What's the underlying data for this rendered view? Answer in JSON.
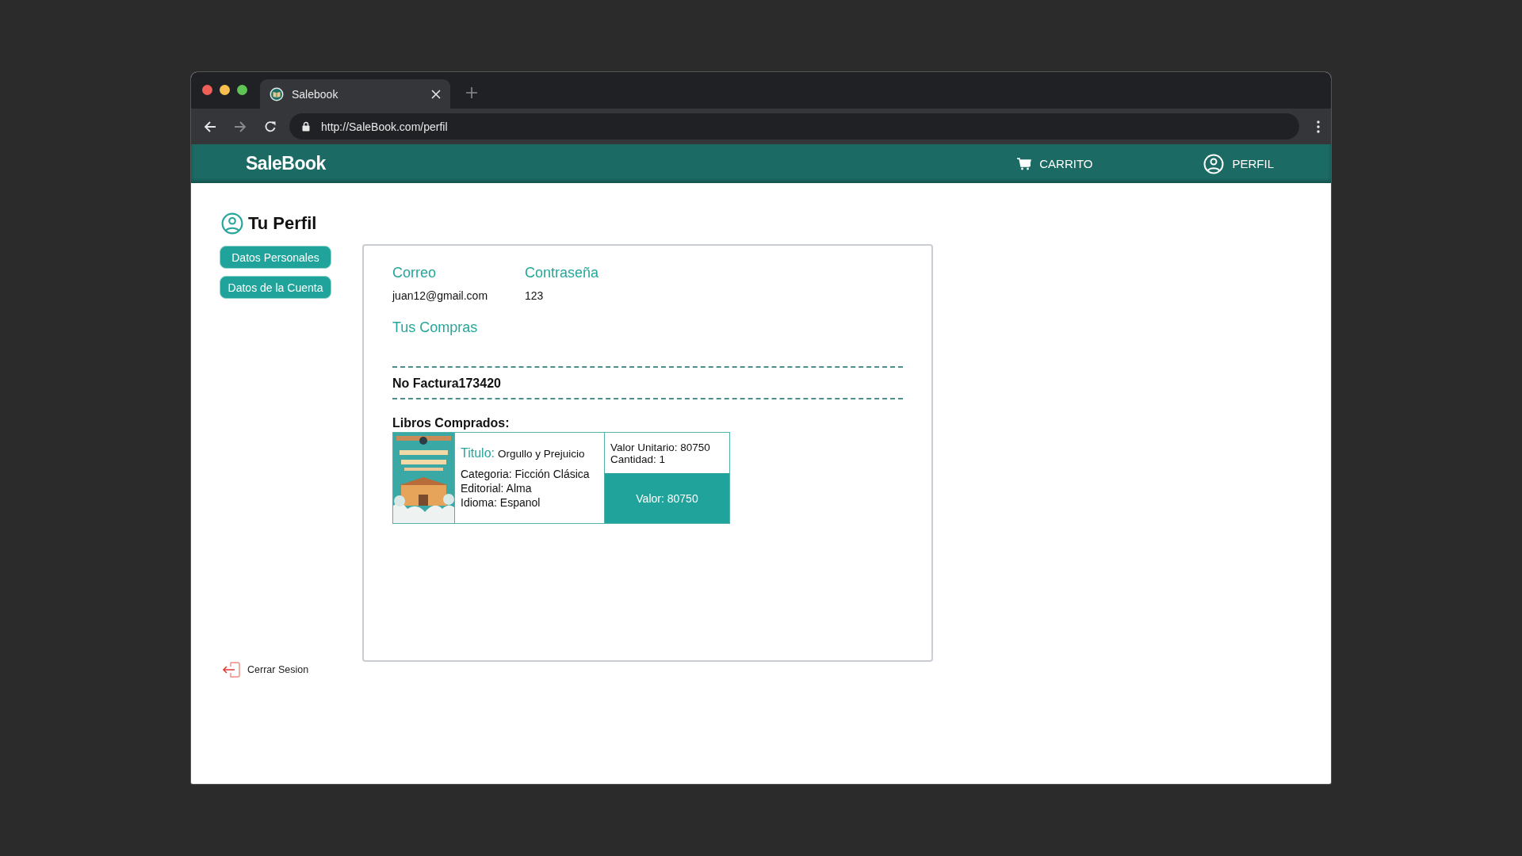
{
  "browser": {
    "tab_title": "Salebook",
    "url": "http://SaleBook.com/perfil"
  },
  "navbar": {
    "brand": "SaleBook",
    "links": [
      {
        "label": "CARRITO"
      },
      {
        "label": "PERFIL"
      }
    ]
  },
  "sidebar": {
    "title": "Tu Perfil",
    "buttons": [
      "Datos Personales",
      "Datos de la Cuenta"
    ],
    "logout": "Cerrar Sesion"
  },
  "account": {
    "fields": [
      {
        "label": "Correo",
        "value": "juan12@gmail.com"
      },
      {
        "label": "Contraseña",
        "value": "123"
      }
    ]
  },
  "purchases": {
    "title": "Tus Compras",
    "invoice": "No Factura173420",
    "books_heading": "Libros Comprados:",
    "items": [
      {
        "title_label": "Titulo:",
        "title": "Orgullo y Prejuicio",
        "details": [
          "Categoria: Ficción Clásica",
          "Editorial: Alma",
          "Idioma: Espanol"
        ],
        "unit_price": "Valor Unitario: 80750",
        "quantity": "Cantidad: 1",
        "total": "Valor: 80750"
      }
    ]
  }
}
